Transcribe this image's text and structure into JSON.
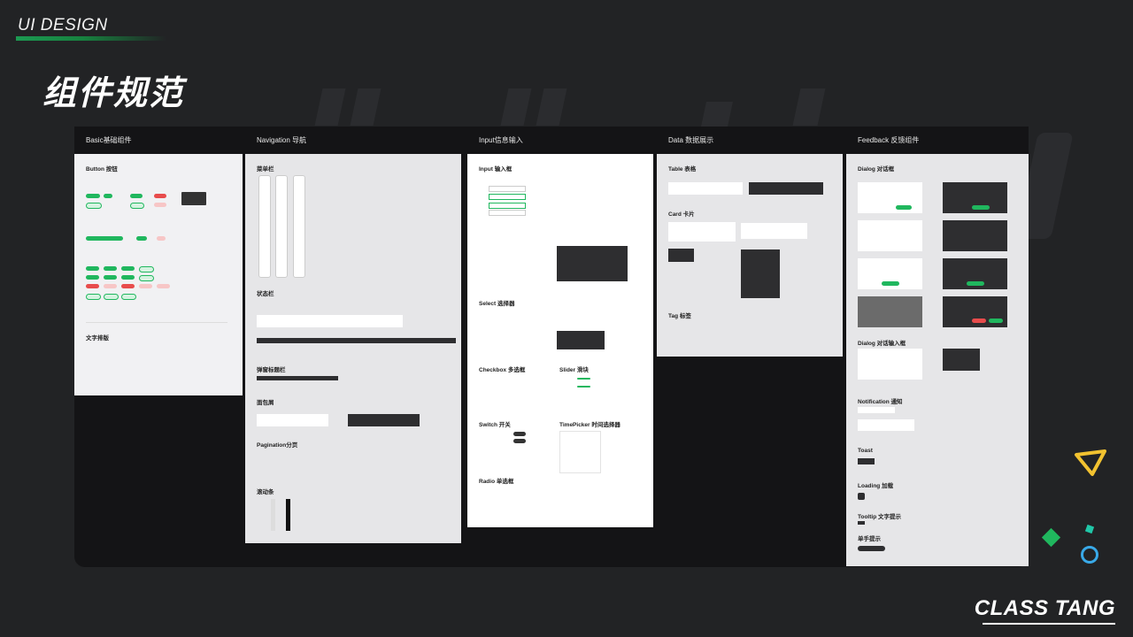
{
  "brand": "UI DESIGN",
  "page_title": "组件规范",
  "footer": "CLASS TANG",
  "columns": [
    {
      "label": "Basic基础组件"
    },
    {
      "label": "Navigation 导航"
    },
    {
      "label": "Input信息输入"
    },
    {
      "label": "Data 数据展示"
    },
    {
      "label": "Feedback 反馈组件"
    }
  ],
  "basic": {
    "button": "Button 按钮",
    "typography": "文字排版"
  },
  "navigation": {
    "menu": "菜单栏",
    "status": "状态栏",
    "popup_title": "弹窗标题栏",
    "breadcrumb": "面包屑",
    "pagination": "Pagination分页",
    "scroll": "滚动条"
  },
  "input": {
    "input": "Input 输入框",
    "select": "Select 选择器",
    "checkbox": "Checkbox 多选框",
    "slider": "Slider 滑块",
    "switch": "Switch 开关",
    "timepicker": "TimePicker 时间选择器",
    "radio": "Radio 单选框"
  },
  "data": {
    "table": "Table 表格",
    "card": "Card 卡片",
    "tag": "Tag 标签"
  },
  "feedback": {
    "dialog": "Dialog 对话框",
    "dialog_input": "Dialog 对话输入框",
    "notification": "Notification 通知",
    "toast": "Toast",
    "loading": "Loading 加载",
    "tooltip": "Tooltip 文字提示",
    "hint": "单手提示"
  },
  "colors": {
    "accent": "#20b75e",
    "danger": "#e84c4c",
    "bg": "#222325",
    "panel": "#141416"
  }
}
